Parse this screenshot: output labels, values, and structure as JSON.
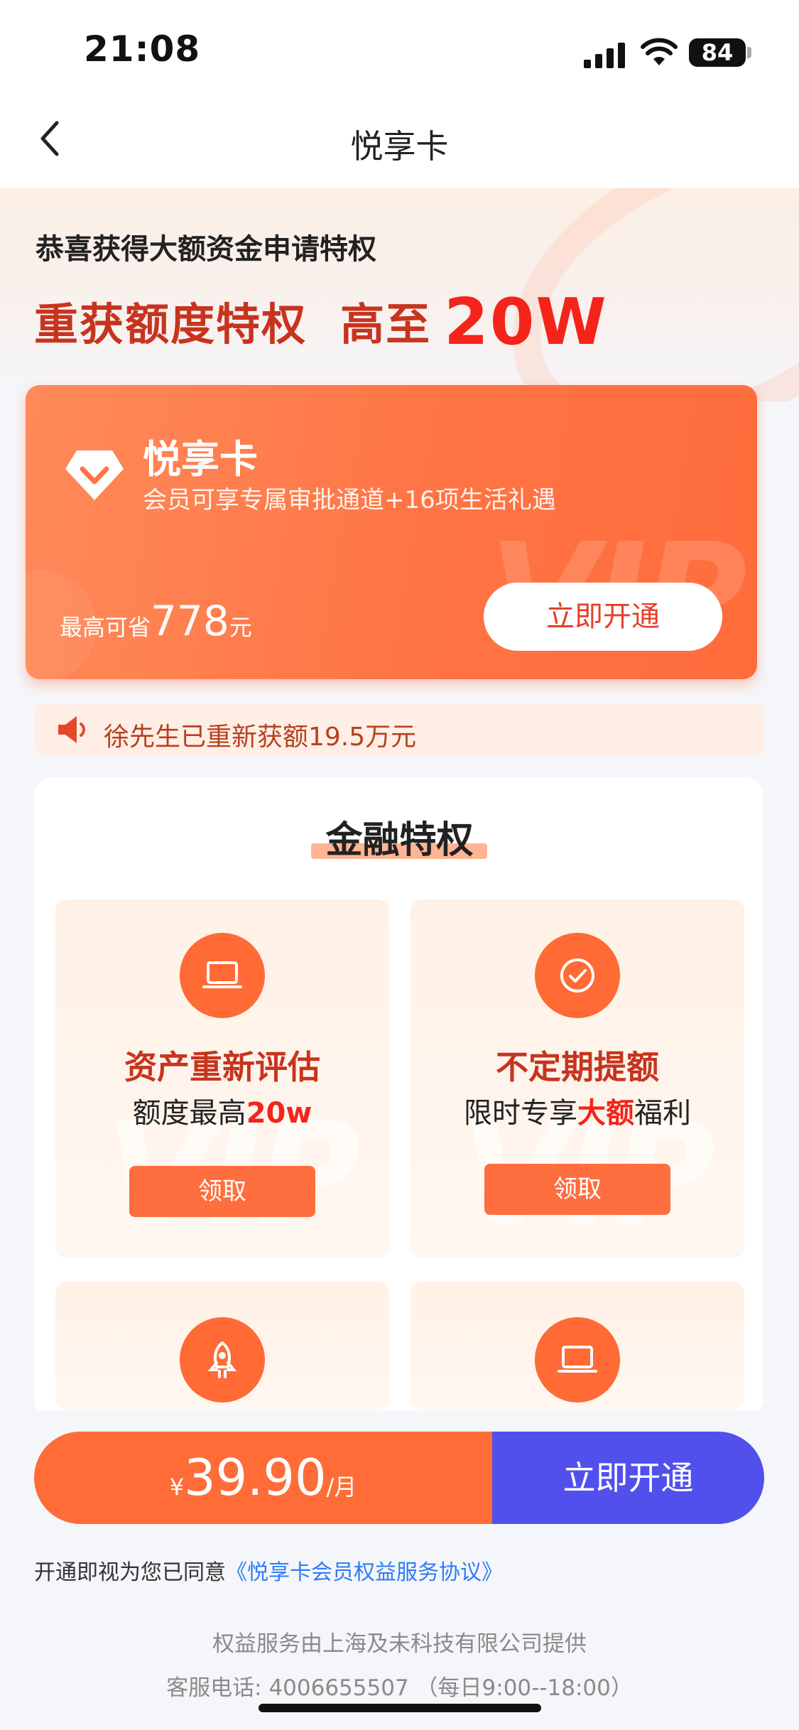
{
  "status_bar": {
    "time": "21:08",
    "battery": "84"
  },
  "nav": {
    "title": "悦享卡"
  },
  "hero": {
    "subtitle": "恭喜获得大额资金申请特权",
    "headline_prefix": "重获额度特权  高至",
    "headline_amount": "20W"
  },
  "card": {
    "title": "悦享卡",
    "desc": "会员可享专属审批通道+16项生活礼遇",
    "save_prefix": "最高可省",
    "save_amount": "778",
    "save_unit": "元",
    "button": "立即开通",
    "watermark": "VIP"
  },
  "notice": {
    "text": "徐先生已重新获额19.5万元"
  },
  "privileges": {
    "title": "金融特权",
    "items": [
      {
        "title": "资产重新评估",
        "sub_prefix": "额度最高",
        "sub_highlight": "20w",
        "sub_suffix": "",
        "button": "领取",
        "icon": "laptop-icon"
      },
      {
        "title": "不定期提额",
        "sub_prefix": "限时专享",
        "sub_highlight": "大额",
        "sub_suffix": "福利",
        "button": "领取",
        "icon": "check-circle-icon"
      },
      {
        "icon": "rocket-icon"
      },
      {
        "icon": "laptop-icon"
      }
    ],
    "watermark": "VIP"
  },
  "purchase": {
    "currency": "¥",
    "price": "39.90",
    "unit": "/月",
    "button": "立即开通"
  },
  "agreement": {
    "prefix": "开通即视为您已同意",
    "link": "《悦享卡会员权益服务协议》"
  },
  "footer": {
    "provider": "权益服务由上海及未科技有限公司提供",
    "hotline": "客服电话: 4006655507 （每日9:00--18:00）"
  },
  "colors": {
    "accent": "#FF6C37",
    "primary_button": "#5250EC",
    "headline_red": "#C7341E",
    "highlight_red": "#F4241A",
    "link_blue": "#2F7CF6"
  }
}
